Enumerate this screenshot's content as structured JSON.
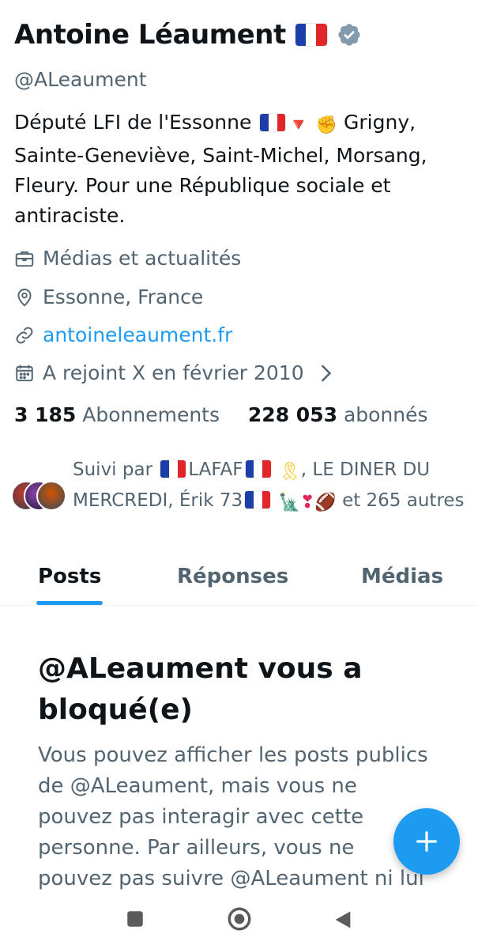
{
  "profile": {
    "name": "Antoine Léaument",
    "handle": "@ALeaument",
    "bio": "Député LFI de l'Essonne",
    "bio_rest": "Grigny, Sainte-Geneviève, Saint-Michel, Morsang, Fleury. Pour une République sociale et antiraciste.",
    "category": "Médias et actualités",
    "location": "Essonne, France",
    "website": "antoineleaument.fr",
    "joined": "A rejoint X en février 2010",
    "following_count": "3 185",
    "following_label": "Abonnements",
    "followers_count": "228 053",
    "followers_label": "abonnés"
  },
  "followed_by": {
    "prefix": "Suivi par",
    "name1": "LAFAF",
    "name2": ", LE DINER DU MERCREDI, Érik 73",
    "suffix": "et 265 autres"
  },
  "tabs": [
    {
      "label": "Posts",
      "active": true
    },
    {
      "label": "Réponses",
      "active": false
    },
    {
      "label": "Médias",
      "active": false
    }
  ],
  "blocked": {
    "title": "@ALeaument vous a bloqué(e)",
    "text": "Vous pouvez afficher les posts publics de @ALeaument, mais vous ne pouvez pas interagir avec cette personne. Par ailleurs, vous ne pouvez pas suivre @ALeaument ni lui"
  },
  "icons": {
    "verified": "verified-badge-icon",
    "category": "briefcase-icon",
    "location": "location-pin-icon",
    "website": "link-icon",
    "joined": "calendar-icon",
    "fab": "plus-icon"
  },
  "colors": {
    "accent": "#1d9bf0",
    "secondary_text": "#536471",
    "primary_text": "#0f1419"
  }
}
